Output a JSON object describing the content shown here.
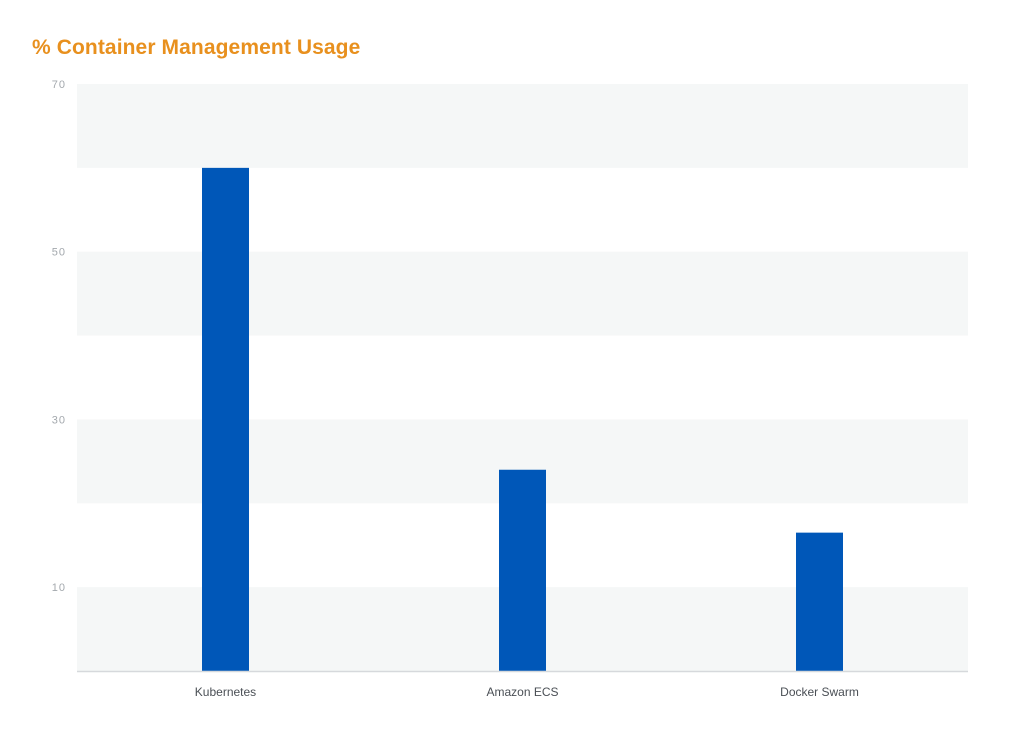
{
  "colors": {
    "title": "#E8901E",
    "bar": "#0057B8",
    "band": "#F5F7F7",
    "axis_line": "#D6D9DC",
    "tick_text": "#A3A8AD",
    "category_text": "#4A4F55"
  },
  "chart_data": {
    "type": "bar",
    "title": "% Container Management Usage",
    "xlabel": "",
    "ylabel": "",
    "categories": [
      "Kubernetes",
      "Amazon ECS",
      "Docker Swarm"
    ],
    "values": [
      60,
      24,
      16.5
    ],
    "ylim": [
      0,
      70
    ],
    "yticks": [
      10,
      30,
      50,
      70
    ],
    "grid": "alternating horizontal bands",
    "legend": "none"
  }
}
